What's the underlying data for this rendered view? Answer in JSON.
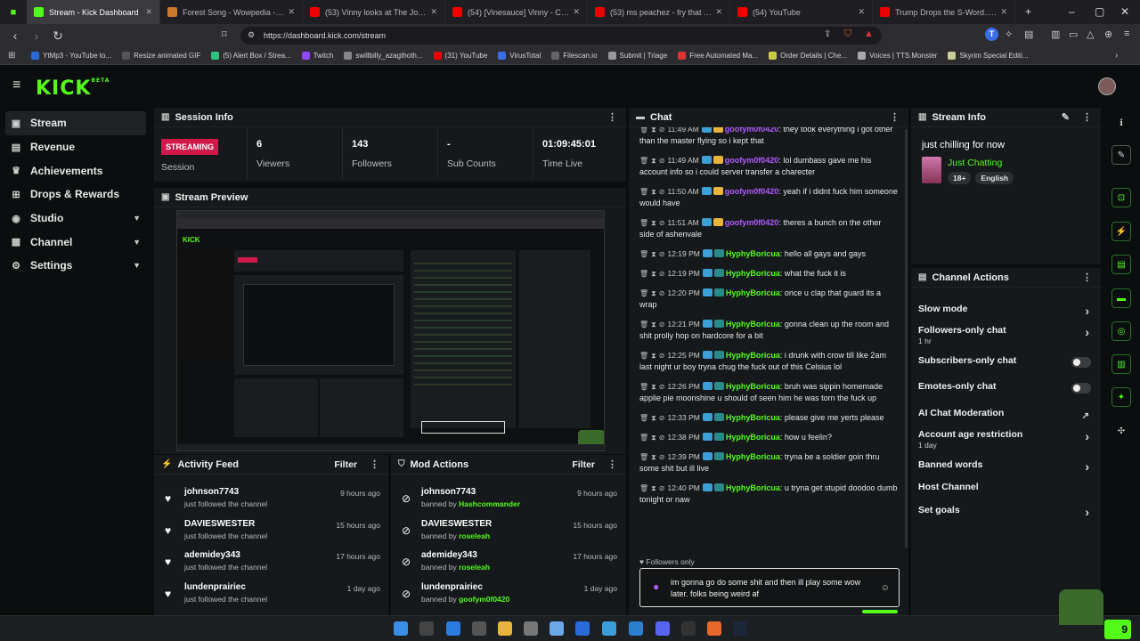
{
  "browser": {
    "tabs": [
      {
        "title": "Stream - Kick Dashboard",
        "color": "#53fc18",
        "active": true
      },
      {
        "title": "Forest Song - Wowpedia - Your wiki",
        "color": "#c97a2a"
      },
      {
        "title": "(53) Vinny looks at The Joker Car Pl",
        "color": "#e00"
      },
      {
        "title": "(54) [Vinesauce] Vinny - Corruption",
        "color": "#e00"
      },
      {
        "title": "(53) ms peachez - fry that chicken",
        "color": "#e00"
      },
      {
        "title": "(54) YouTube",
        "color": "#e00"
      },
      {
        "title": "Trump Drops the S-Word... and The",
        "color": "#e00"
      }
    ],
    "url": "https://dashboard.kick.com/stream",
    "bookmarks": [
      {
        "label": "YtMp3 - YouTube to...",
        "color": "#2a6bd8"
      },
      {
        "label": "Resize animated GIF",
        "color": "#555"
      },
      {
        "label": "(5) Alert Box / Strea...",
        "color": "#31c27c"
      },
      {
        "label": "Twitch",
        "color": "#9146ff"
      },
      {
        "label": "swillbilly_azagthoth...",
        "color": "#888"
      },
      {
        "label": "(31) YouTube",
        "color": "#e00"
      },
      {
        "label": "VirusTotal",
        "color": "#3a6ee8"
      },
      {
        "label": "Filescan.io",
        "color": "#666"
      },
      {
        "label": "Submit | Triage",
        "color": "#999"
      },
      {
        "label": "Free Automated Ma...",
        "color": "#d33"
      },
      {
        "label": "Order Details | Che...",
        "color": "#cc4"
      },
      {
        "label": "Voices | TTS.Monster",
        "color": "#aaa"
      },
      {
        "label": "Skyrim Special Editi...",
        "color": "#cc9"
      }
    ]
  },
  "app": {
    "logo": "KICK",
    "logo_sup": "BETA"
  },
  "sidebar": {
    "items": [
      {
        "label": "Stream",
        "icon": "video-icon",
        "glyph": "▣"
      },
      {
        "label": "Revenue",
        "icon": "revenue-icon",
        "glyph": "▤"
      },
      {
        "label": "Achievements",
        "icon": "trophy-icon",
        "glyph": "♛"
      },
      {
        "label": "Drops & Rewards",
        "icon": "gift-icon",
        "glyph": "⊞"
      },
      {
        "label": "Studio",
        "icon": "studio-icon",
        "glyph": "◉"
      },
      {
        "label": "Channel",
        "icon": "channel-icon",
        "glyph": "▦"
      },
      {
        "label": "Settings",
        "icon": "settings-icon",
        "glyph": "⚙"
      }
    ]
  },
  "session": {
    "title": "Session Info",
    "status": "STREAMING",
    "status_label": "Session",
    "stats": [
      {
        "value": "6",
        "label": "Viewers"
      },
      {
        "value": "143",
        "label": "Followers"
      },
      {
        "value": "-",
        "label": "Sub Counts"
      },
      {
        "value": "01:09:45:01",
        "label": "Time Live"
      }
    ]
  },
  "preview": {
    "title": "Stream Preview"
  },
  "activity_feed": {
    "title": "Activity Feed",
    "filter": "Filter",
    "items": [
      {
        "name": "johnson7743",
        "sub": "just followed the channel",
        "time": "9 hours ago"
      },
      {
        "name": "DAVIESWESTER",
        "sub": "just followed the channel",
        "time": "15 hours ago"
      },
      {
        "name": "ademidey343",
        "sub": "just followed the channel",
        "time": "17 hours ago"
      },
      {
        "name": "lundenprairiec",
        "sub": "just followed the channel",
        "time": "1 day ago"
      }
    ]
  },
  "mod_actions": {
    "title": "Mod Actions",
    "filter": "Filter",
    "items": [
      {
        "name": "johnson7743",
        "pre": "banned by",
        "by": "Hashcommander",
        "time": "9 hours ago"
      },
      {
        "name": "DAVIESWESTER",
        "pre": "banned by",
        "by": "roseleah",
        "time": "15 hours ago"
      },
      {
        "name": "ademidey343",
        "pre": "banned by",
        "by": "roseleah",
        "time": "17 hours ago"
      },
      {
        "name": "lundenprairiec",
        "pre": "banned by",
        "by": "goofym0f0420",
        "time": "1 day ago"
      }
    ]
  },
  "chat": {
    "title": "Chat",
    "messages": [
      {
        "time": "11:49 AM",
        "user": "goofym0f0420",
        "color": "#b05cff",
        "text": "they took everything i got other than the master flying so i kept that"
      },
      {
        "time": "11:49 AM",
        "user": "goofym0f0420",
        "color": "#b05cff",
        "text": "lol dumbass gave me his account info so i could server transfer a charecter"
      },
      {
        "time": "11:50 AM",
        "user": "goofym0f0420",
        "color": "#b05cff",
        "text": "yeah if i didnt fuck him someone would have"
      },
      {
        "time": "11:51 AM",
        "user": "goofym0f0420",
        "color": "#b05cff",
        "text": "theres a bunch on the other side of ashenvale"
      },
      {
        "time": "12:19 PM",
        "user": "HyphyBoricua",
        "color": "#53fc18",
        "text": "hello all gays and gays"
      },
      {
        "time": "12:19 PM",
        "user": "HyphyBoricua",
        "color": "#53fc18",
        "text": "what the fuck it is"
      },
      {
        "time": "12:20 PM",
        "user": "HyphyBoricua",
        "color": "#53fc18",
        "text": "once u clap that guard its a wrap"
      },
      {
        "time": "12:21 PM",
        "user": "HyphyBoricua",
        "color": "#53fc18",
        "text": "gonna clean up the room and shit prolly hop on hardcore for a bit"
      },
      {
        "time": "12:25 PM",
        "user": "HyphyBoricua",
        "color": "#53fc18",
        "text": "i drunk with crow till like 2am last night ur boy tryna chug the fuck out of this Celsius lol"
      },
      {
        "time": "12:26 PM",
        "user": "HyphyBoricua",
        "color": "#53fc18",
        "text": "bruh was sippin homemade applie pie moonshine u should of seen him he was torn the fuck up"
      },
      {
        "time": "12:33 PM",
        "user": "HyphyBoricua",
        "color": "#53fc18",
        "text": "please give me yerts please"
      },
      {
        "time": "12:38 PM",
        "user": "HyphyBoricua",
        "color": "#53fc18",
        "text": "how u feelin?"
      },
      {
        "time": "12:39 PM",
        "user": "HyphyBoricua",
        "color": "#53fc18",
        "text": "tryna be a soldier goin thru some shit but ill live"
      },
      {
        "time": "12:40 PM",
        "user": "HyphyBoricua",
        "color": "#53fc18",
        "text": "u tryna get stupid doodoo dumb tonight or naw"
      }
    ],
    "followers_only": "Followers only",
    "input_value": "im gonna go do some shit and then ill play some wow later. folks being weird af"
  },
  "stream_info": {
    "title": "Stream Info",
    "stream_title": "just chilling for now",
    "category": "Just Chatting",
    "tags": [
      "18+",
      "English"
    ]
  },
  "channel_actions": {
    "title": "Channel Actions",
    "items": [
      {
        "label": "Slow mode",
        "control": "chevron"
      },
      {
        "label": "Followers-only chat",
        "sub": "1 hr",
        "control": "chevron"
      },
      {
        "label": "Subscribers-only chat",
        "control": "toggle"
      },
      {
        "label": "Emotes-only chat",
        "control": "toggle"
      },
      {
        "label": "AI Chat Moderation",
        "control": "external"
      },
      {
        "label": "Account age restriction",
        "sub": "1 day",
        "control": "chevron"
      },
      {
        "label": "Banned words",
        "control": "chevron"
      },
      {
        "label": "Host Channel",
        "control": "none"
      },
      {
        "label": "Set goals",
        "control": "chevron"
      }
    ]
  },
  "taskbar": {
    "badge": "9"
  }
}
